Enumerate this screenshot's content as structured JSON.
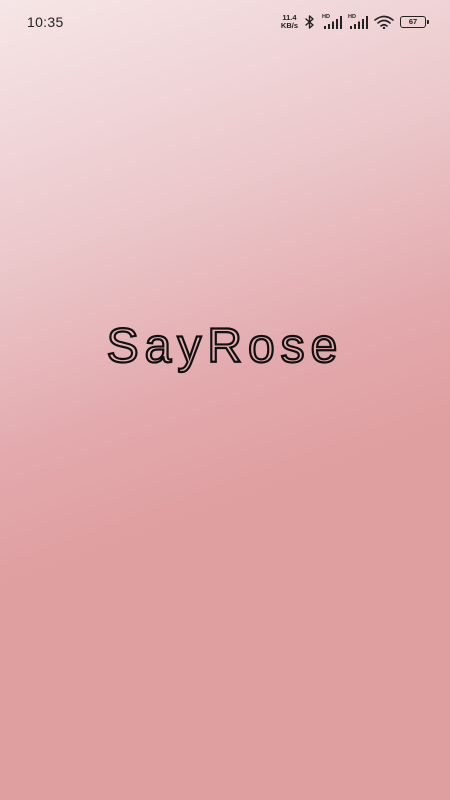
{
  "status_bar": {
    "time": "10:35",
    "network_speed_value": "11.4",
    "network_speed_unit": "KB/s",
    "sim1_tag": "HD",
    "sim2_tag": "HD",
    "battery_level": "67",
    "icons": [
      "bluetooth-icon",
      "signal-icon",
      "signal-icon",
      "wifi-icon",
      "battery-icon"
    ]
  },
  "splash": {
    "logo_text": "SayRose"
  },
  "colors": {
    "background_top": "#f6e6e7",
    "background_bottom": "#df9e9f",
    "text": "#111111"
  }
}
